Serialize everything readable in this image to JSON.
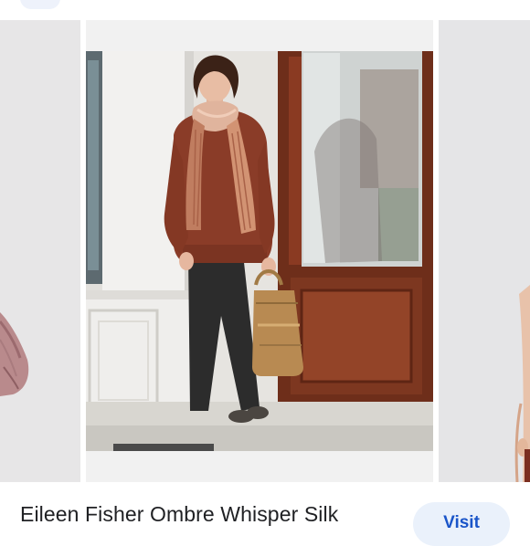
{
  "result": {
    "title": "Eileen Fisher Ombre Whisper Silk",
    "visit_label": "Visit"
  },
  "icons": {
    "top_pill": "pill-button"
  },
  "colors": {
    "accent": "#1a55c9",
    "visit_bg": "#eaf1fb",
    "sweater": "#8a3c28",
    "scarf": "#d9a68e",
    "door": "#6e2e1a"
  }
}
